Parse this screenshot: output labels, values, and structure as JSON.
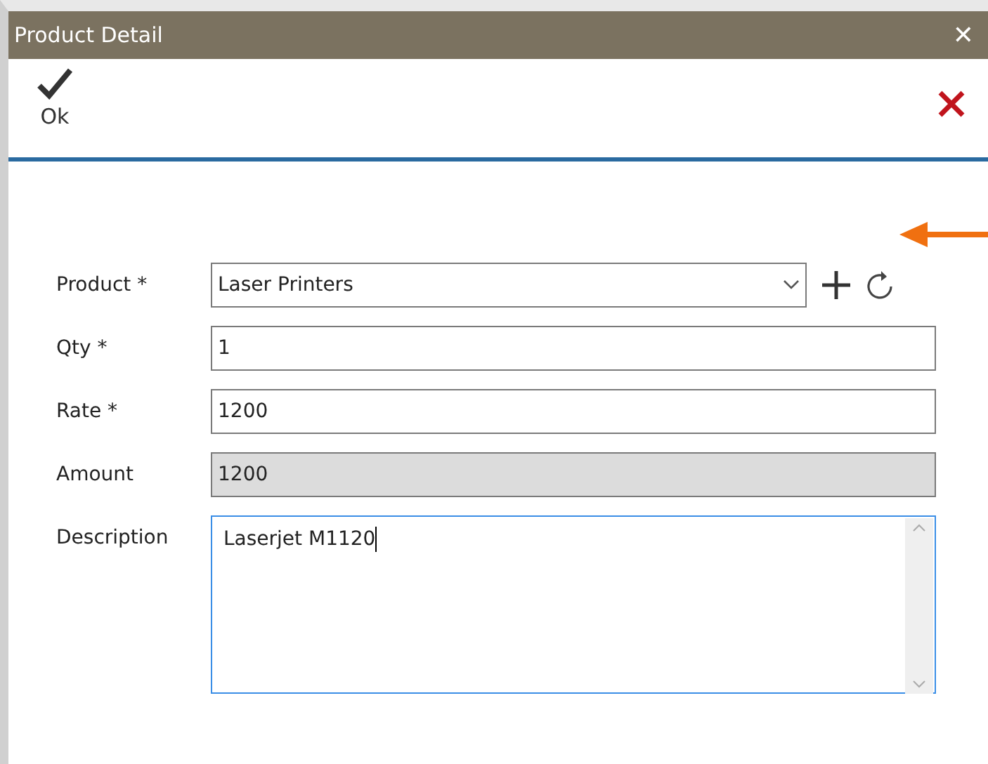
{
  "window": {
    "title": "Product Detail",
    "close": "✕"
  },
  "toolbar": {
    "ok_label": "Ok"
  },
  "fields": [
    {
      "label": "Product *",
      "kind": "dropdown",
      "value": "Laser Printers",
      "focused": false
    },
    {
      "label": "Qty *",
      "kind": "text",
      "value": "1",
      "focused": false
    },
    {
      "label": "Rate *",
      "kind": "text",
      "value": "1200",
      "focused": false
    },
    {
      "label": "Amount",
      "kind": "readonly",
      "value": "1200",
      "focused": false
    },
    {
      "label": "Description",
      "kind": "textarea",
      "value": "Laserjet M1120",
      "focused": true
    }
  ]
}
